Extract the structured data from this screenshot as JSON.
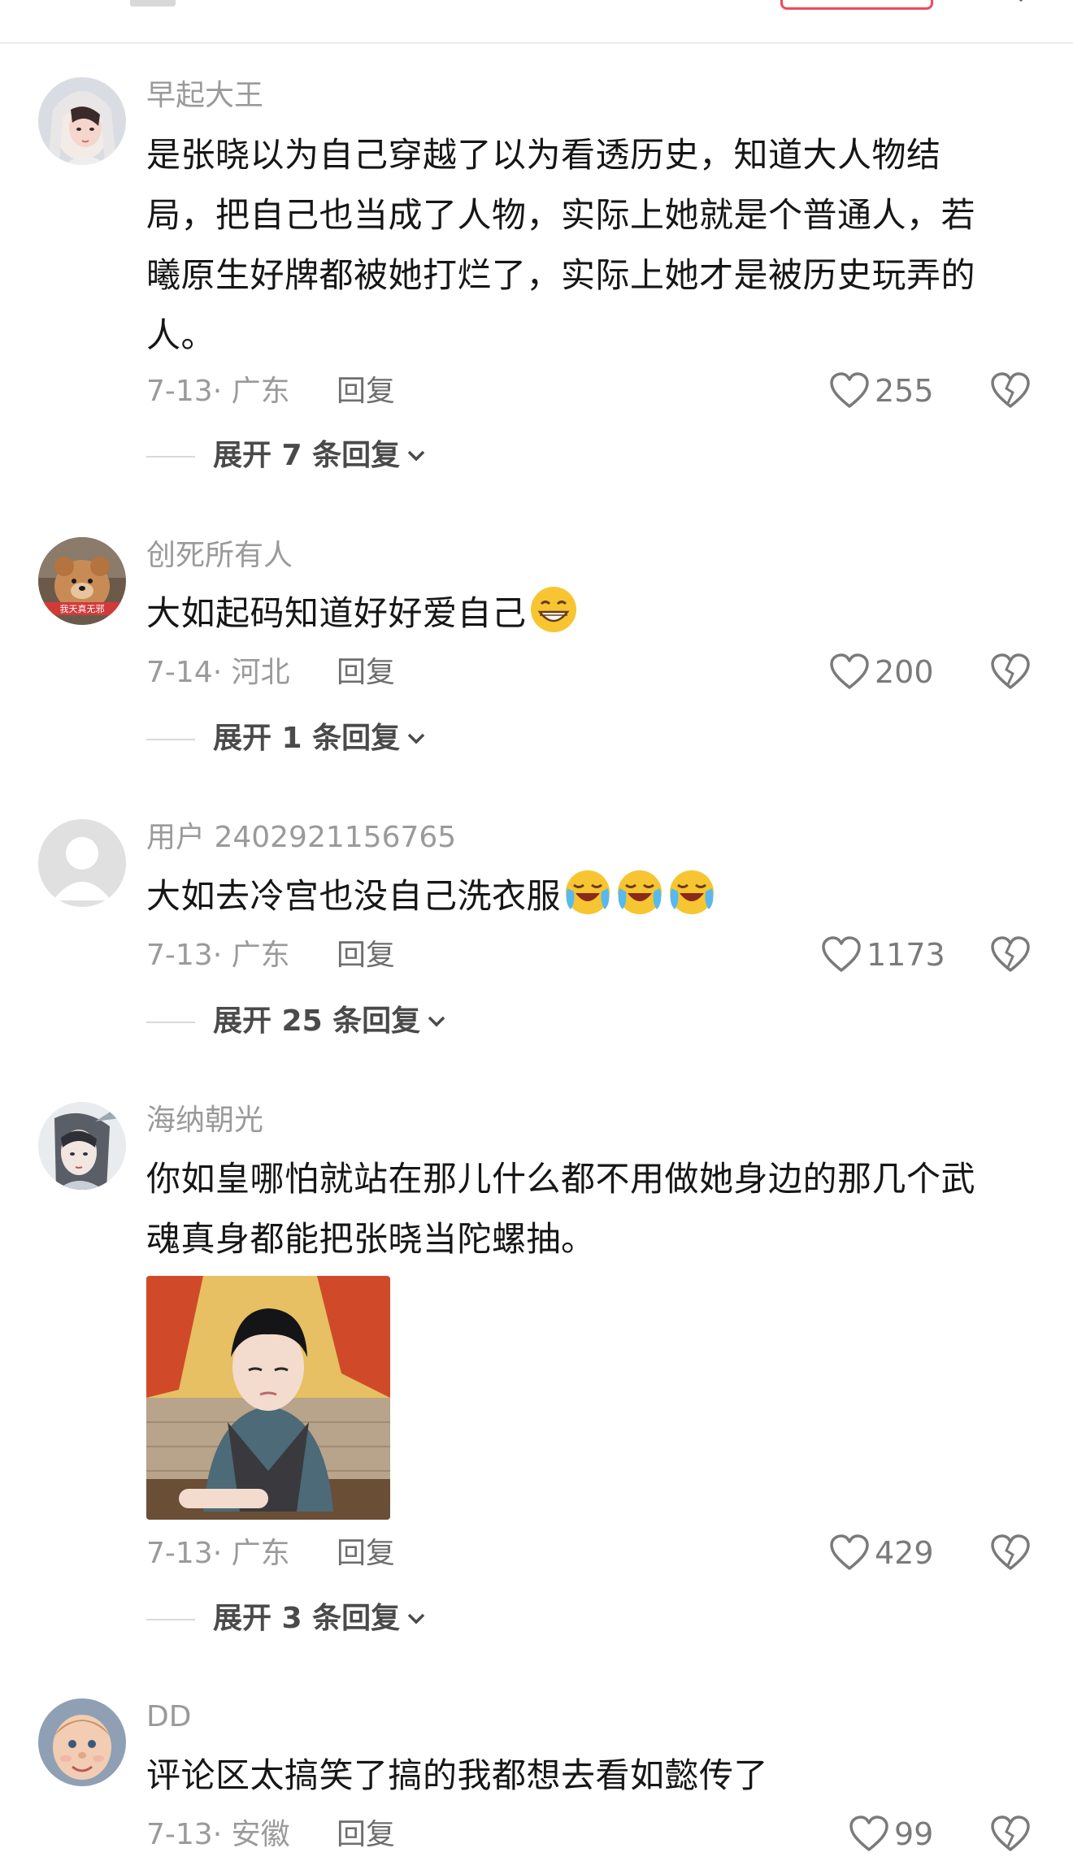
{
  "comments": [
    {
      "username": "早起大王",
      "text": "是张晓以为自己穿越了以为看透历史，知道大人物结局，把自己也当成了人物，实际上她就是个普通人，若曦原生好牌都被她打烂了，实际上她才是被历史玩弄的人。",
      "date_location": "7-13· 广东",
      "reply_label": "回复",
      "likes": "255",
      "expand_label": "展开 7 条回复"
    },
    {
      "username": "创死所有人",
      "avatar_caption": "我天真无邪",
      "text": "大如起码知道好好爱自己",
      "emojis": [
        "grin-emoji"
      ],
      "date_location": "7-14· 河北",
      "reply_label": "回复",
      "likes": "200",
      "expand_label": "展开 1 条回复"
    },
    {
      "username": "用户 2402921156765",
      "text": "大如去冷宫也没自己洗衣服",
      "emojis": [
        "crying-laugh-emoji",
        "crying-laugh-emoji",
        "crying-laugh-emoji"
      ],
      "date_location": "7-13· 广东",
      "reply_label": "回复",
      "likes": "1173",
      "expand_label": "展开 25 条回复"
    },
    {
      "username": "海纳朝光",
      "text": "你如皇哪怕就站在那儿什么都不用做她身边的那几个武魂真身都能把张晓当陀螺抽。",
      "has_image": true,
      "date_location": "7-13· 广东",
      "reply_label": "回复",
      "likes": "429",
      "expand_label": "展开 3 条回复"
    },
    {
      "username": "DD",
      "text": "评论区太搞笑了搞的我都想去看如懿传了",
      "date_location": "7-13· 安徽",
      "reply_label": "回复",
      "likes": "99"
    }
  ],
  "colors": {
    "accent": "#f04a5e",
    "meta_gray": "#9a9a9a",
    "text_dark": "#161616"
  },
  "icons": [
    "heart-outline-icon",
    "broken-heart-icon",
    "chevron-down-icon"
  ]
}
